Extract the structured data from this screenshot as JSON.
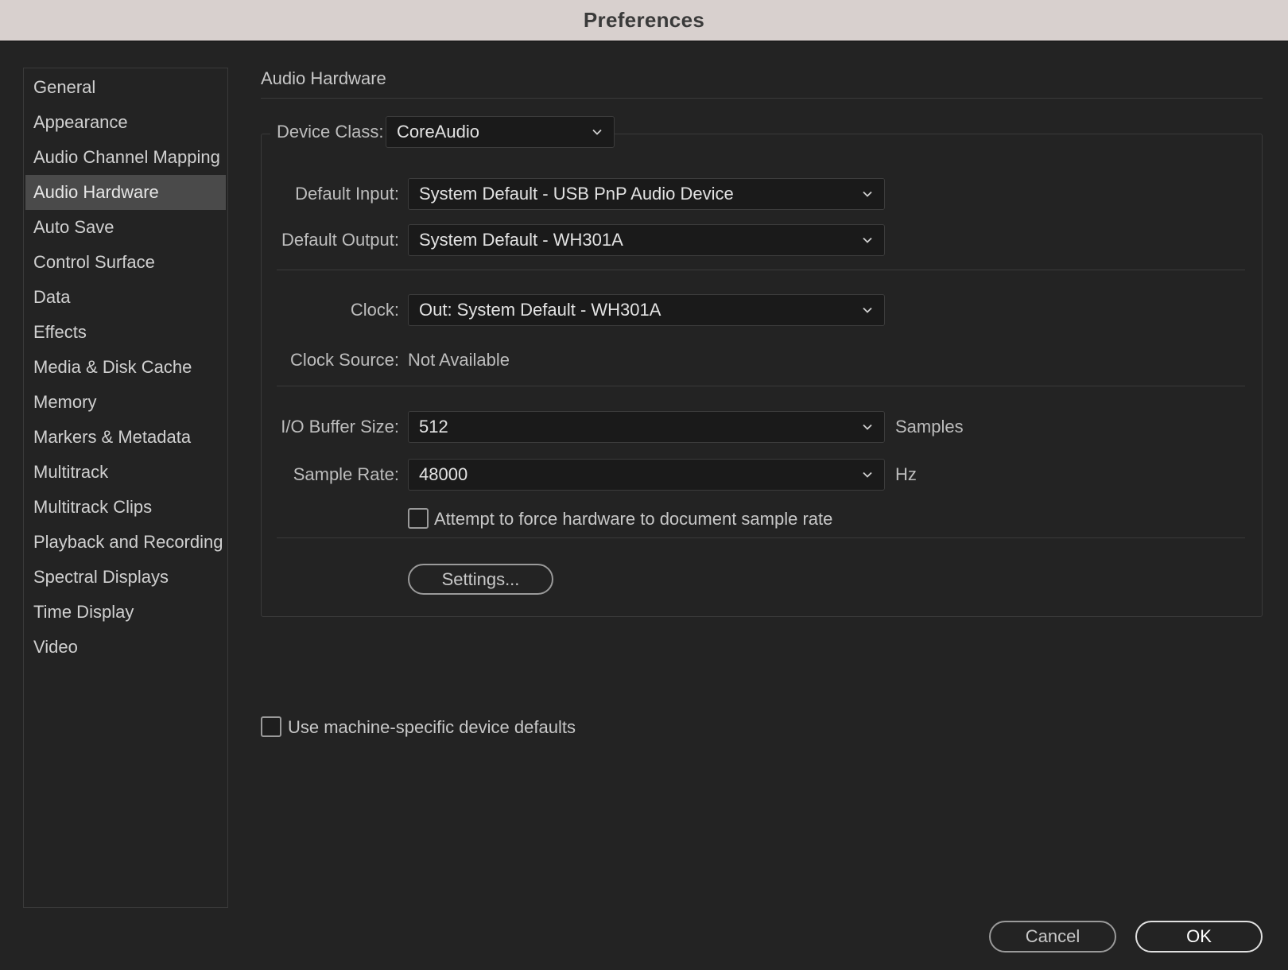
{
  "window": {
    "title": "Preferences"
  },
  "sidebar": {
    "items": [
      {
        "label": "General"
      },
      {
        "label": "Appearance"
      },
      {
        "label": "Audio Channel Mapping"
      },
      {
        "label": "Audio Hardware",
        "selected": true
      },
      {
        "label": "Auto Save"
      },
      {
        "label": "Control Surface"
      },
      {
        "label": "Data"
      },
      {
        "label": "Effects"
      },
      {
        "label": "Media & Disk Cache"
      },
      {
        "label": "Memory"
      },
      {
        "label": "Markers & Metadata"
      },
      {
        "label": "Multitrack"
      },
      {
        "label": "Multitrack Clips"
      },
      {
        "label": "Playback and Recording"
      },
      {
        "label": "Spectral Displays"
      },
      {
        "label": "Time Display"
      },
      {
        "label": "Video"
      }
    ]
  },
  "main": {
    "section_title": "Audio Hardware",
    "device_class": {
      "label": "Device Class:",
      "value": "CoreAudio"
    },
    "default_input": {
      "label": "Default Input:",
      "value": "System Default - USB PnP Audio Device"
    },
    "default_output": {
      "label": "Default Output:",
      "value": "System Default - WH301A"
    },
    "clock": {
      "label": "Clock:",
      "value": "Out: System Default - WH301A"
    },
    "clock_source": {
      "label": "Clock Source:",
      "value": "Not Available"
    },
    "io_buffer_size": {
      "label": "I/O Buffer Size:",
      "value": "512",
      "unit": "Samples"
    },
    "sample_rate": {
      "label": "Sample Rate:",
      "value": "48000",
      "unit": "Hz"
    },
    "force_sample_rate": {
      "label": "Attempt to force hardware to document sample rate",
      "checked": false
    },
    "settings_button": "Settings...",
    "machine_defaults": {
      "label": "Use machine-specific device defaults",
      "checked": false
    }
  },
  "footer": {
    "cancel_label": "Cancel",
    "ok_label": "OK"
  },
  "colors": {
    "background": "#232323",
    "titlebar": "#d8d0ce",
    "selected_item": "#4a4a4a",
    "field_bg": "#1a1a1a"
  }
}
